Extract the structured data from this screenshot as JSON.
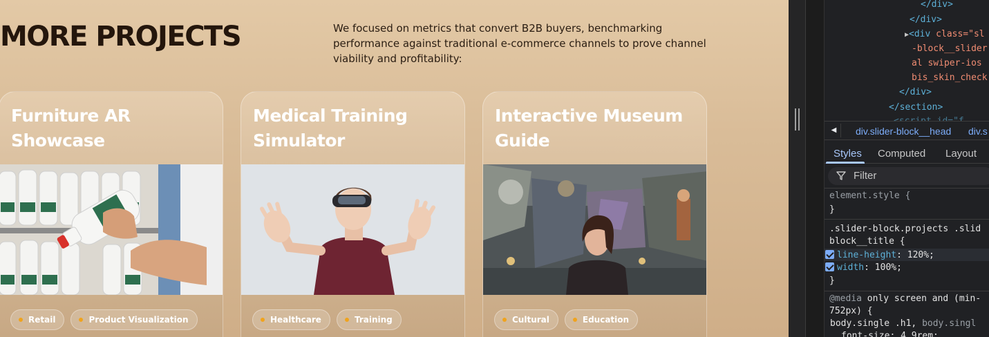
{
  "page": {
    "heading": "MORE PROJECTS",
    "intro": "We focused on metrics that convert B2B buyers, benchmarking performance against traditional e-commerce channels to prove channel viability and profitability:"
  },
  "projects": [
    {
      "title_line1": "Furniture AR",
      "title_line2": "Showcase",
      "tags": [
        "Retail",
        "Product Visualization"
      ]
    },
    {
      "title_line1": "Medical Training",
      "title_line2": "Simulator",
      "tags": [
        "Healthcare",
        "Training"
      ]
    },
    {
      "title_line1": "Interactive Museum",
      "title_line2": "Guide",
      "tags": [
        "Cultural",
        "Education"
      ]
    }
  ],
  "colors": {
    "tag_dot": "#f0a31c",
    "heading": "#24160c",
    "devtools_bg": "#202124",
    "devtools_accent": "#a8c7fa"
  },
  "devtools": {
    "dom": {
      "l1": "</div>",
      "l2": "</div>",
      "l3_tag": "<div ",
      "l3_attr": "class=\"sl",
      "l4": "-block__slider",
      "l5": "al swiper-ios",
      "l6": "bis_skin_check",
      "l7": "</div>",
      "l8": "</section>",
      "l9": "<script id=\"f"
    },
    "breadcrumbs": [
      "div.slider-block__head",
      "div.s"
    ],
    "tabs": [
      "Styles",
      "Computed",
      "Layout"
    ],
    "filter_placeholder": "Filter",
    "styles": {
      "element_style": "element.style {",
      "close": "}",
      "selector_l1": ".slider-block.projects .slid",
      "selector_l2": "block__title {",
      "prop1_name": "line-height",
      "prop1_value": "120%;",
      "prop2_name": "width",
      "prop2_value": "100%;",
      "media_l1_a": "@media ",
      "media_l1_b": "only screen and (min-",
      "media_l2": "752px) {",
      "media_sel_a": "body.single .h1, ",
      "media_sel_b": "body.singl",
      "media_prop": "font-size: 4.9rem;"
    }
  }
}
